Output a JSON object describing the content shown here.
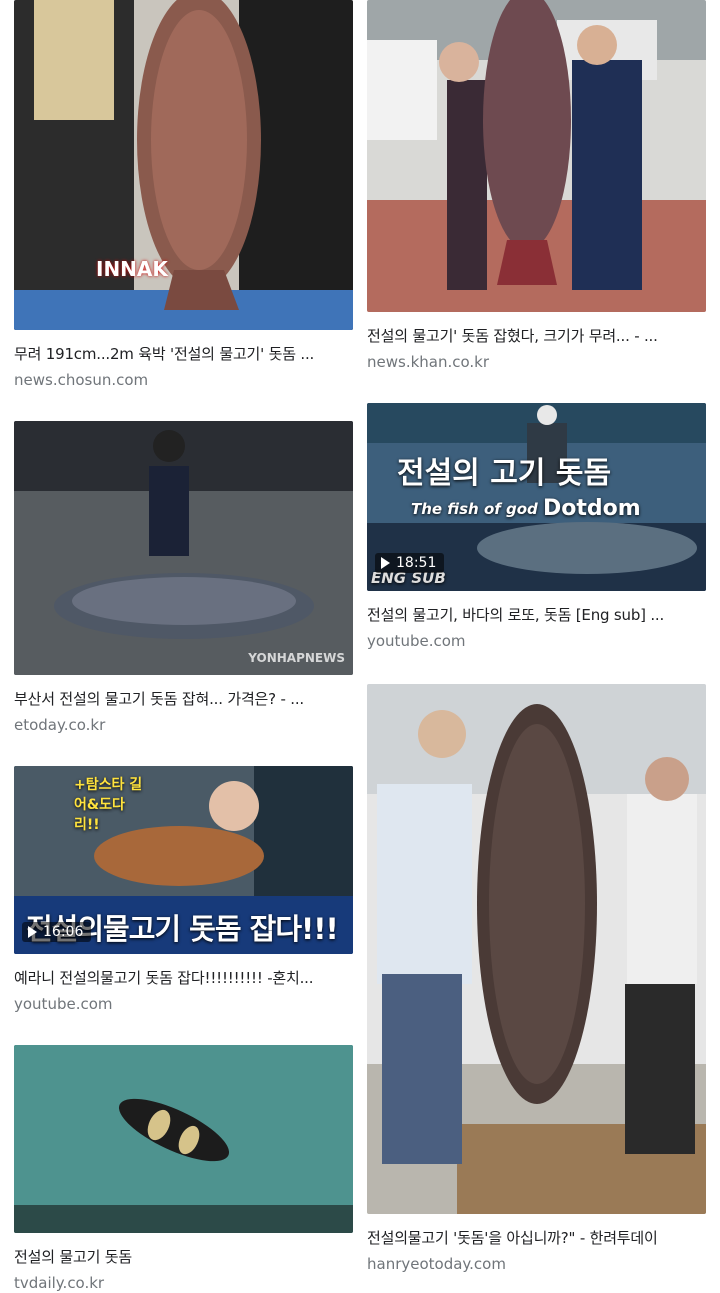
{
  "results": [
    {
      "caption": "무려 191cm...2m 육박 '전설의 물고기' 돗돔 ...",
      "source": "news.chosun.com",
      "watermark": "INNAK"
    },
    {
      "caption": "전설의 물고기' 돗돔 잡혔다, 크기가 무려... - ...",
      "source": "news.khan.co.kr"
    },
    {
      "caption": "부산서 전설의 물고기 돗돔 잡혀... 가격은? - ...",
      "source": "etoday.co.kr",
      "watermark": "YONHAPNEWS"
    },
    {
      "caption": "전설의 물고기, 바다의 로또, 돗돔 [Eng sub] ...",
      "source": "youtube.com",
      "duration": "18:51",
      "overlay_title": "전설의 고기 돗돔",
      "overlay_sub": "The fish of god",
      "overlay_en": "Dotdom",
      "overlay_tag": "ENG SUB"
    },
    {
      "caption": "예라니 전설의물고기 돗돔 잡다!!!!!!!!!! -혼치...",
      "source": "youtube.com",
      "duration": "16:06",
      "overlay_title": "전설의물고기 돗돔 잡다!!!",
      "overlay_side": "+탐스타 길어&도다리!!"
    },
    {
      "caption": "전설의물고기 '돗돔'을 아십니까?\" - 한려투데이",
      "source": "hanryeotoday.com"
    },
    {
      "caption": "전설의 물고기 돗돔",
      "source": "tvdaily.co.kr"
    }
  ],
  "colors": {
    "text": "#202124",
    "source": "#70757a",
    "bg": "#ffffff"
  }
}
